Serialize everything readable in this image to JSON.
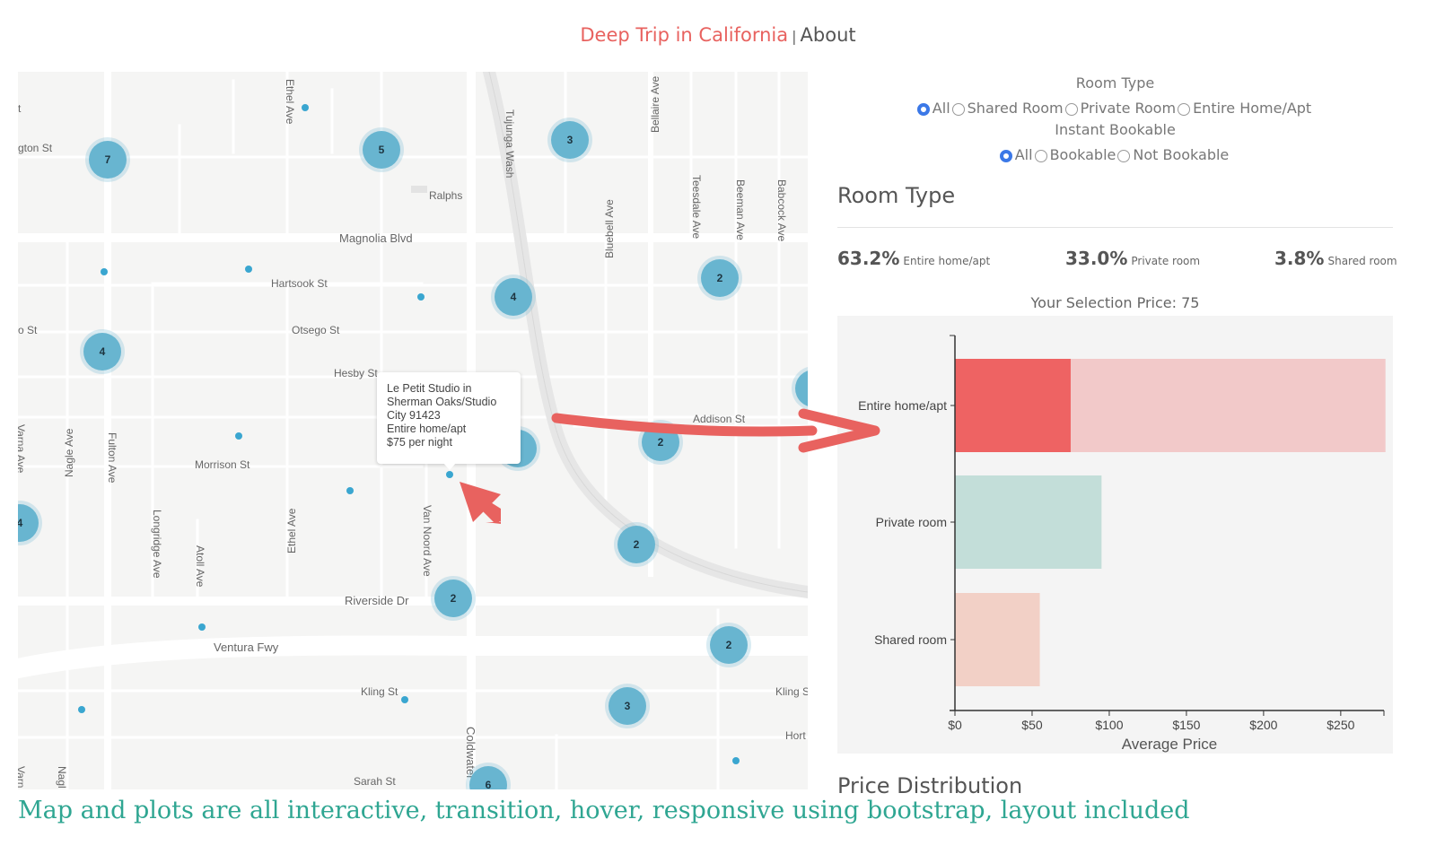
{
  "header": {
    "brand": "Deep Trip in California",
    "separator": "|",
    "about": "About"
  },
  "map": {
    "streets": {
      "ethel_ave_top": "Ethel Ave",
      "tujunga_wash": "Tujunga Wash",
      "bellaire_ave": "Bellaire Ave",
      "teesdale_ave": "Teesdale Ave",
      "beeman_ave": "Beeman Ave",
      "babcock_ave": "Babcock Ave",
      "bluebell_ave": "Bluebell Ave",
      "arlington_st": "gton St",
      "ralphs": "Ralphs",
      "magnolia_blvd": "Magnolia Blvd",
      "hartsook_st": "Hartsook St",
      "otsego_st": "Otsego St",
      "left_st": "o St",
      "hesby_st": "Hesby St",
      "addison_st": "Addison St",
      "varna_ave": "Varna Ave",
      "nagle_ave": "Nagle Ave",
      "fulton_ave": "Fulton Ave",
      "morrison_st": "Morrison St",
      "longridge_ave": "Longridge Ave",
      "atoll_ave": "Atoll Ave",
      "ethel_ave": "Ethel Ave",
      "van_noord_ave": "Van Noord Ave",
      "riverside_dr": "Riverside Dr",
      "ventura_fwy": "Ventura Fwy",
      "kling_st": "Kling St",
      "kling_st_right": "Kling S",
      "coldwater": "Coldwater",
      "sarah_st": "Sarah St",
      "hort": "Hort",
      "varn_bottom": "Varn",
      "nagl_bottom": "Nagl",
      "t_left": "t"
    },
    "clusters": [
      "7",
      "5",
      "3",
      "2",
      "4",
      "4",
      "2",
      "2",
      "4",
      "2",
      "2",
      "3",
      "6"
    ],
    "popup": {
      "line1": "Le Petit Studio in",
      "line2": "Sherman Oaks/Studio",
      "line3": "City 91423",
      "line4": "Entire home/apt",
      "line5": "$75 per night"
    }
  },
  "filters": {
    "room_type_label": "Room Type",
    "room_type_options": [
      "All",
      "Shared Room",
      "Private Room",
      "Entire Home/Apt"
    ],
    "room_type_selected": "All",
    "bookable_label": "Instant Bookable",
    "bookable_options": [
      "All",
      "Bookable",
      "Not Bookable"
    ],
    "bookable_selected": "All"
  },
  "room_type": {
    "title": "Room Type",
    "stats": [
      {
        "pct": "63.2%",
        "label": "Entire home/apt"
      },
      {
        "pct": "33.0%",
        "label": "Private room"
      },
      {
        "pct": "3.8%",
        "label": "Shared room"
      }
    ],
    "selection_price": "Your Selection Price: 75"
  },
  "chart_data": {
    "type": "bar",
    "orientation": "horizontal",
    "categories": [
      "Entire home/apt",
      "Private room",
      "Shared room"
    ],
    "values": [
      279,
      95,
      55
    ],
    "selection_value": 75,
    "xlabel": "Average Price",
    "xticks": [
      "$0",
      "$50",
      "$100",
      "$150",
      "$200",
      "$250"
    ],
    "xlim": [
      0,
      278
    ],
    "colors": {
      "entire_selected": "#ee6363",
      "entire_rest": "#f2c9c9",
      "private": "#c3ded9",
      "shared": "#f2d0c6"
    }
  },
  "price_distribution": {
    "title": "Price Distribution"
  },
  "caption": "Map and plots are all interactive, transition, hover, responsive using bootstrap, layout included"
}
